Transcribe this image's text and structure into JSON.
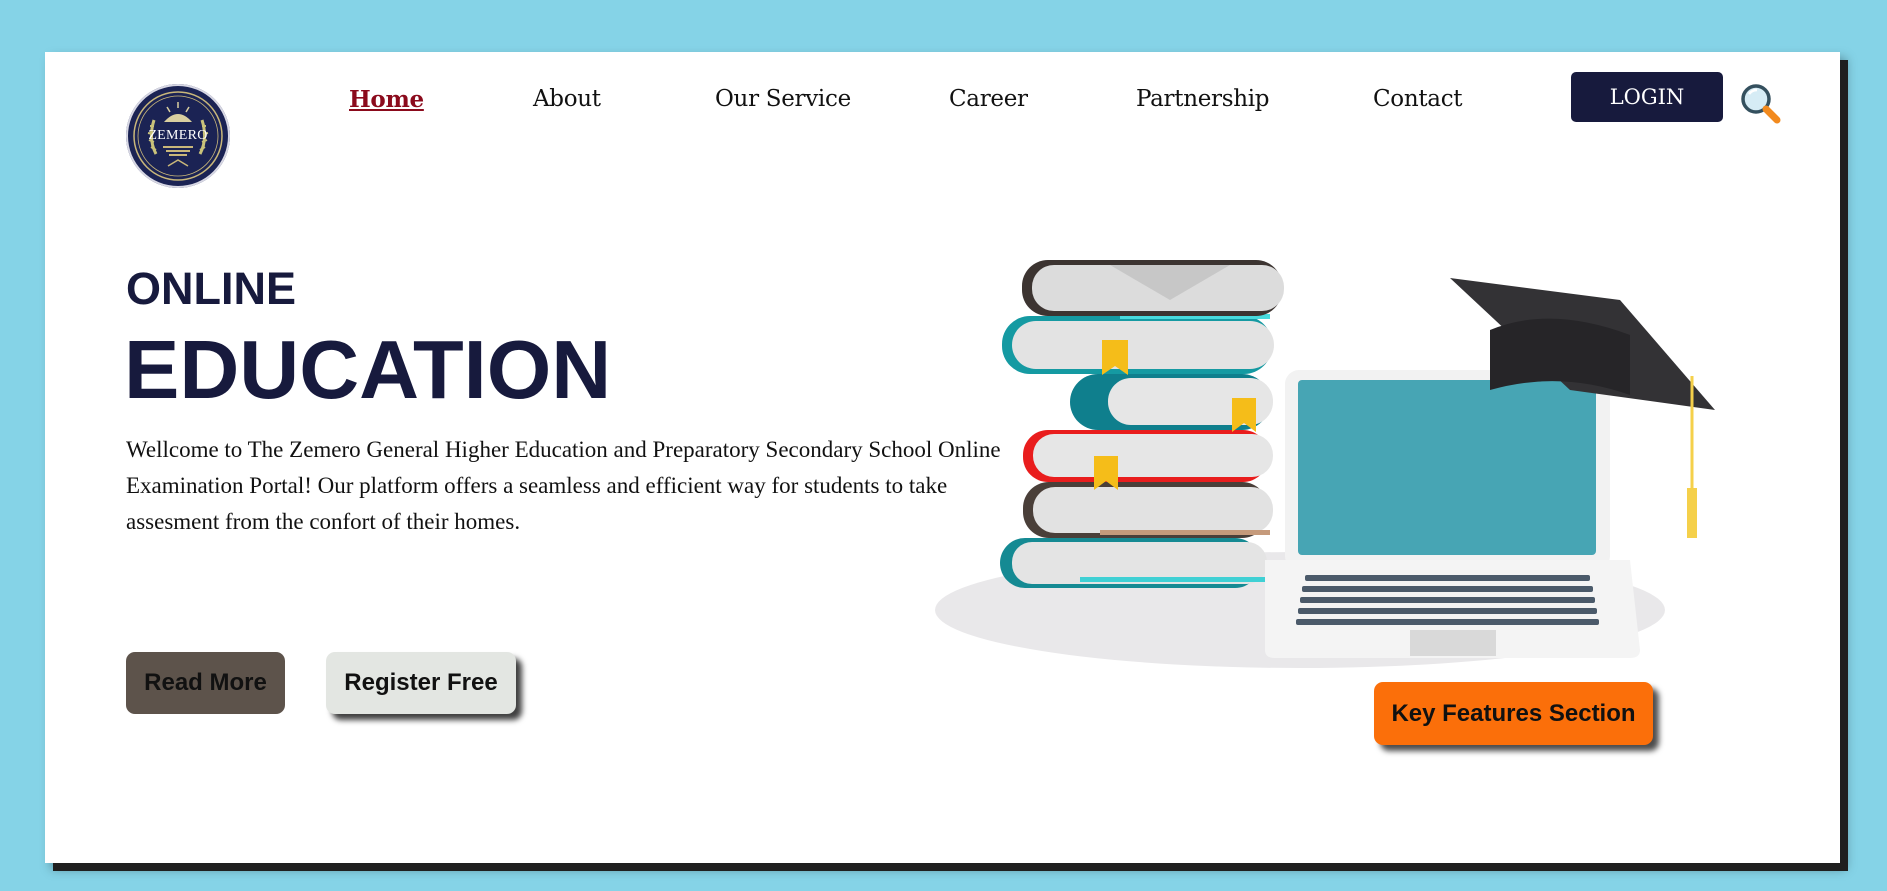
{
  "logo": {
    "text": "ZEMERO"
  },
  "nav": {
    "items": [
      {
        "label": "Home",
        "active": true
      },
      {
        "label": "About"
      },
      {
        "label": "Our Service"
      },
      {
        "label": "Career"
      },
      {
        "label": "Partnership"
      },
      {
        "label": "Contact"
      }
    ],
    "login_label": "LOGIN",
    "search_icon": "magnifier-icon"
  },
  "hero": {
    "line1": "ONLINE",
    "line2": "EDUCATION",
    "paragraph": "Wellcome to The Zemero General Higher Education and Preparatory Secondary School Online Examination Portal! Our platform offers a seamless and efficient way for students to take assesment from the confort of their homes.",
    "read_more": "Read More",
    "register": "Register Free",
    "key_features": "Key Features Section"
  },
  "colors": {
    "page_bg": "#85d3e7",
    "navy": "#171a3d",
    "active_link": "#8b0a1c",
    "orange": "#fb6f0a",
    "read_more_bg": "#5d534b",
    "register_bg": "#e3e6e2"
  },
  "illustration": {
    "icon": "books-laptop-graduation-cap-illustration"
  }
}
